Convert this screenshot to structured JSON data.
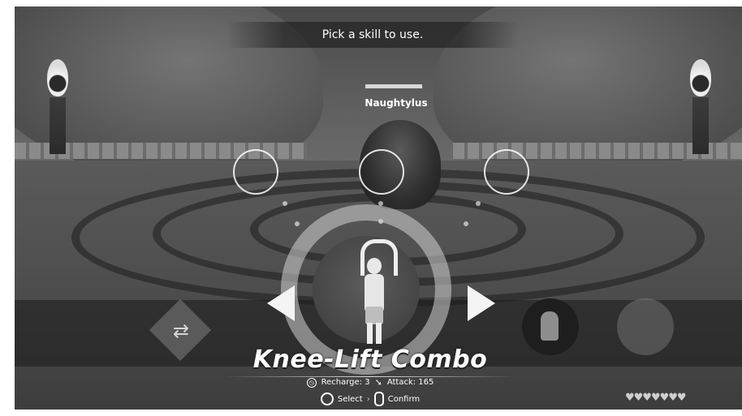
{
  "prompt": "Pick a skill to use.",
  "enemy": {
    "name": "Naughtylus"
  },
  "skill": {
    "name": "Knee-Lift Combo",
    "recharge": "Recharge: 3",
    "attack": "Attack: 165"
  },
  "controls": {
    "select": "Select",
    "confirm": "Confirm"
  },
  "hearts": "♥♥♥♥♥♥♥"
}
